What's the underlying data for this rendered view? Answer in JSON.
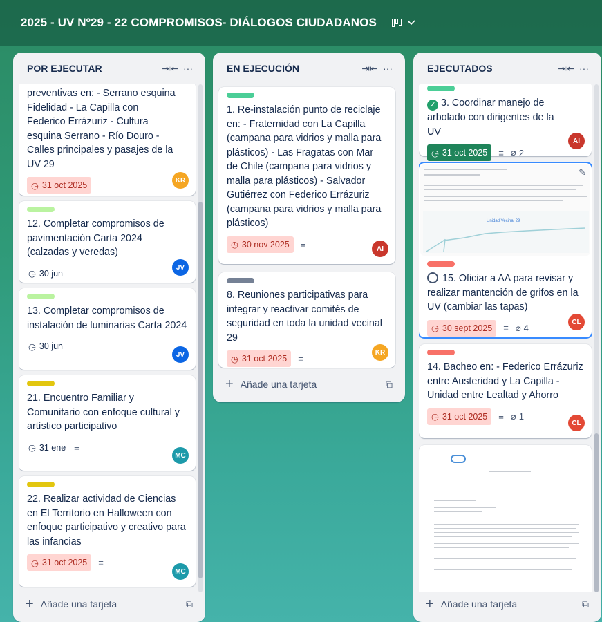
{
  "board": {
    "title": "2025 - UV Nº29 - 22 COMPROMISOS- DIÁLOGOS CIUDADANOS",
    "view_icon": "board-view-icon"
  },
  "lists": [
    {
      "title": "POR EJECUTAR",
      "add_label": "Añade una tarjeta",
      "cards": [
        {
          "title": "preventivas en: - Serrano esquina Fidelidad - La Capilla con Federico Errázuriz - Cultura esquina Serrano - Río Douro - Calles principales y pasajes de la UV 29",
          "date": "31 oct 2025",
          "avatar": "KR"
        },
        {
          "title": "12. Completar compromisos de pavimentación Carta 2024 (calzadas y veredas)",
          "date": "30 jun",
          "avatar": "JV"
        },
        {
          "title": "13. Completar compromisos de instalación de luminarias Carta 2024",
          "date": "30 jun",
          "avatar": "JV"
        },
        {
          "title": "21. Encuentro Familiar y Comunitario con enfoque cultural y artístico participativo",
          "date": "31 ene",
          "avatar": "MC"
        },
        {
          "title": "22. Realizar actividad de Ciencias en El Territorio en Halloween con enfoque participativo y creativo para las infancias",
          "date": "31 oct 2025",
          "avatar": "MC"
        }
      ]
    },
    {
      "title": "EN EJECUCIÓN",
      "add_label": "Añade una tarjeta",
      "cards": [
        {
          "title": "1. Re-instalación punto de reciclaje en: - Fraternidad con La Capilla (campana para vidrios y malla para plásticos) - Las Fragatas con Mar de Chile (campana para vidrios y malla para plásticos) - Salvador Gutiérrez con Federico Errázuriz (campana para vidrios y malla para plásticos)",
          "date": "30 nov 2025",
          "avatar": "AI"
        },
        {
          "title": "8. Reuniones participativas para integrar y reactivar comités de seguridad en toda la unidad vecinal 29",
          "date": "31 oct 2025",
          "avatar": "KR"
        }
      ]
    },
    {
      "title": "EJECUTADOS",
      "add_label": "Añade una tarjeta",
      "cards": [
        {
          "title": "3. Coordinar manejo de arbolado con dirigentes de la UV",
          "date": "31 oct 2025",
          "attachments": "2",
          "avatar": "AI"
        },
        {
          "title": "15. Oficiar a AA para revisar y realizar mantención de grifos en la UV (cambiar las tapas)",
          "date": "30 sept 2025",
          "attachments": "4",
          "avatar": "CL",
          "thumb_chart_label": "Unidad Vecinal 29"
        },
        {
          "title": "14. Bacheo en: - Federico Errázuriz entre Austeridad y La Capilla - Unidad entre Lealtad y Ahorro",
          "date": "31 oct 2025",
          "attachments": "1",
          "avatar": "CL"
        }
      ]
    }
  ],
  "colors": {
    "label_green": "#4bce97",
    "label_lime": "#baf3a0",
    "label_yellow": "#e2c60f",
    "label_gray": "#758195",
    "label_red": "#f87168",
    "avatar_KR": "#f5a623",
    "avatar_JV": "#0c66e4",
    "avatar_MC": "#1d9aaa",
    "avatar_AI": "#c9372c",
    "avatar_CL": "#e34935"
  }
}
